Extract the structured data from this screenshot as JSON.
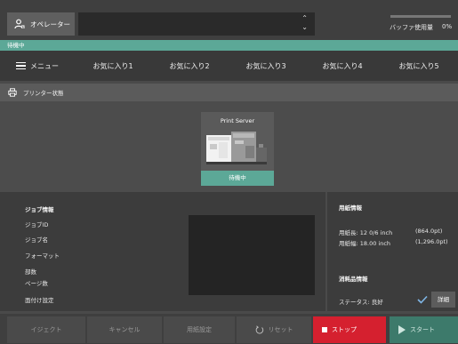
{
  "topbar": {
    "operator_label": "オペレーター",
    "operator_icon": "operator-user-icon",
    "buffer_label": "バッファ使用量",
    "buffer_value": "0%",
    "buffer_fraction": 0
  },
  "status": {
    "text": "待機中"
  },
  "nav": {
    "menu_label": "メニュー",
    "favorites": [
      "お気に入り1",
      "お気に入り2",
      "お気に入り3",
      "お気に入り4",
      "お気に入り5"
    ]
  },
  "printer_section": {
    "title": "プリンター状態",
    "card_title": "Print Server",
    "card_status": "待機中"
  },
  "job_info": {
    "title": "ジョブ情報",
    "rows": [
      "ジョブID",
      "ジョブ名",
      "フォーマット",
      "部数",
      "ページ数",
      "面付け設定"
    ]
  },
  "paper_info": {
    "title": "用紙情報",
    "length_label": "用紙長: 12 0/6 inch",
    "length_value": "(864.0pt)",
    "width_label": "用紙幅: 18.00 inch",
    "width_value": "(1,296.0pt)"
  },
  "consumables": {
    "title": "消耗品情報",
    "status_label": "ステータス: 良好",
    "detail_label": "詳細"
  },
  "actions": {
    "eject": "イジェクト",
    "cancel": "キャンセル",
    "paper_settings": "用紙設定",
    "reset": "リセット",
    "stop": "ストップ",
    "start": "スタート"
  },
  "colors": {
    "accent": "#5ca897",
    "stop": "#d5202f",
    "start": "#3d7a6b",
    "background": "#4a4a4a"
  }
}
